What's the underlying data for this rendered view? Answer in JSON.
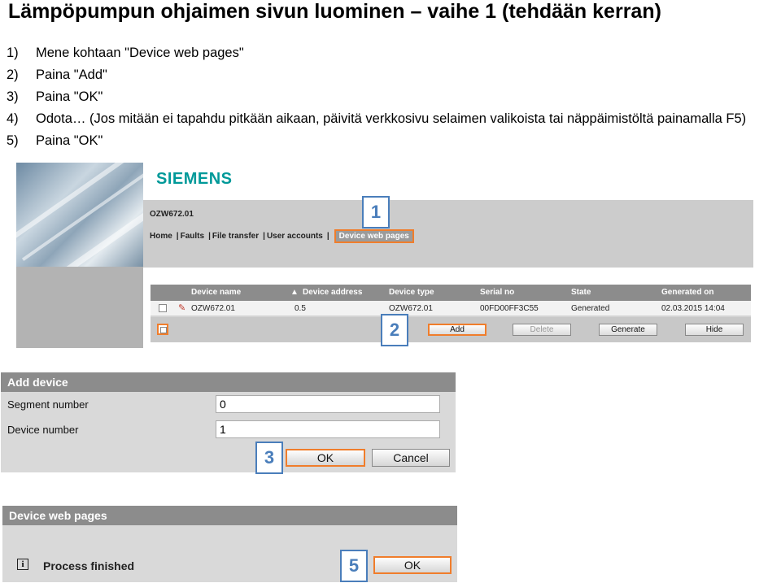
{
  "title": "Lämpöpumpun ohjaimen sivun luominen – vaihe 1 (tehdään kerran)",
  "steps": [
    {
      "num": "1)",
      "text": "Mene kohtaan \"Device web pages\""
    },
    {
      "num": "2)",
      "text": "Paina \"Add\""
    },
    {
      "num": "3)",
      "text": "Paina \"OK\""
    },
    {
      "num": "4)",
      "text": "Odota… (Jos mitään ei tapahdu pitkään aikaan, päivitä verkkosivu selaimen valikoista tai näppäimistöltä painamalla F5)"
    },
    {
      "num": "5)",
      "text": "Paina \"OK\""
    }
  ],
  "screen1": {
    "brand": "SIEMENS",
    "device_title": "OZW672.01",
    "nav": {
      "home": "Home",
      "faults": "Faults",
      "file_transfer": "File transfer",
      "user_accounts": "User accounts",
      "device_web_pages": "Device web pages",
      "separator": "|"
    },
    "table": {
      "headers": {
        "device_name": "Device name",
        "device_address": "Device address",
        "device_type": "Device type",
        "serial_no": "Serial no",
        "state": "State",
        "generated_on": "Generated on"
      },
      "row": {
        "device_name": "OZW672.01",
        "device_address": "0.5",
        "device_type": "OZW672.01",
        "serial_no": "00FD00FF3C55",
        "state": "Generated",
        "generated_on": "02.03.2015 14:04"
      }
    },
    "buttons": {
      "add": "Add",
      "delete": "Delete",
      "generate": "Generate",
      "hide": "Hide"
    }
  },
  "add_device": {
    "header": "Add device",
    "segment_label": "Segment number",
    "segment_value": "0",
    "device_label": "Device number",
    "device_value": "1",
    "ok": "OK",
    "cancel": "Cancel"
  },
  "web_pages_panel": {
    "header": "Device web pages",
    "message": "Process finished",
    "ok": "OK"
  },
  "callouts": [
    "1",
    "2",
    "3",
    "5"
  ],
  "colors": {
    "highlight": "#f07d2b",
    "callout": "#4a7ebb",
    "brand": "#009999"
  }
}
